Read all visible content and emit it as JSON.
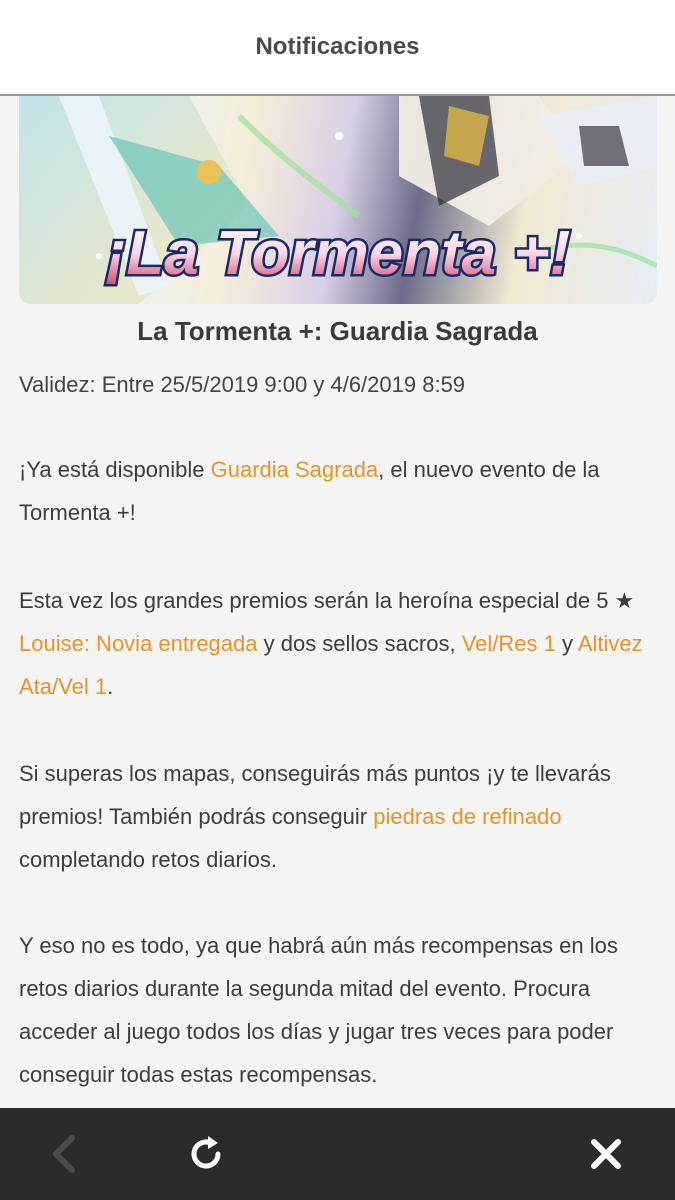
{
  "header": {
    "title": "Notificaciones"
  },
  "banner": {
    "text": "¡La Tormenta +!"
  },
  "article": {
    "title": "La Tormenta +: Guardia Sagrada",
    "validity": "Validez: Entre 25/5/2019 9:00 y 4/6/2019 8:59",
    "p1": {
      "a": "¡Ya está disponible ",
      "link": "Guardia Sagrada",
      "b": ", el nuevo evento de la Tormenta +!"
    },
    "p2": {
      "a": "Esta vez los grandes premios serán la heroína especial de 5 ★ ",
      "link1": "Louise: Novia entregada",
      "b": " y dos sellos sacros, ",
      "link2": "Vel/Res 1",
      "c": " y ",
      "link3": "Altivez Ata/Vel 1",
      "d": "."
    },
    "p3": {
      "a": "Si superas los mapas, conseguirás más puntos ¡y te llevarás premios! También podrás conseguir ",
      "link": "piedras de refinado",
      "b": " completando retos diarios."
    },
    "p4": "Y eso no es todo, ya que habrá aún más recompensas en los retos diarios durante la segunda mitad del evento. Procura acceder al juego todos los días y jugar tres veces para poder conseguir todas estas recompensas."
  },
  "nav": {
    "back_icon": "chevron-left-icon",
    "reload_icon": "reload-icon",
    "close_icon": "close-icon"
  },
  "colors": {
    "link": "#e8932a",
    "bar": "#2b2b2b"
  }
}
